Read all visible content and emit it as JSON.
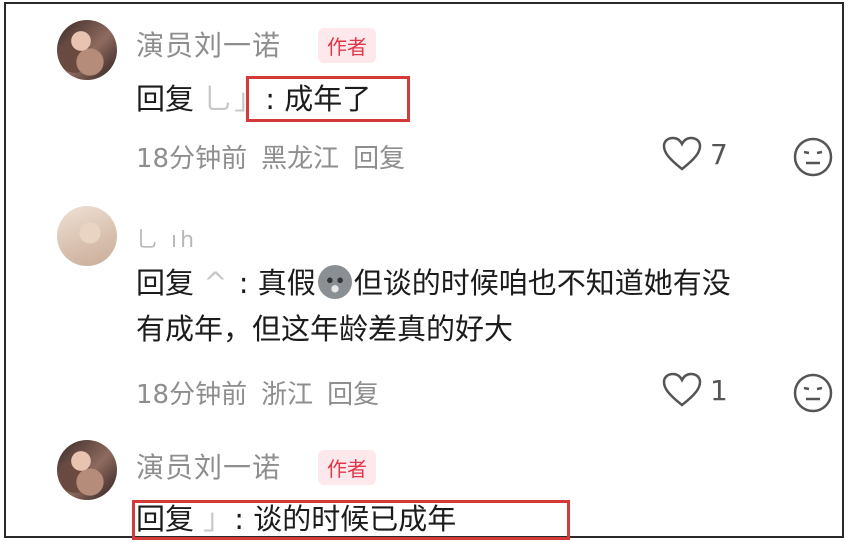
{
  "comments": [
    {
      "username": "演员刘一诺",
      "badge": "作者",
      "reply_prefix": "回复",
      "reply_target": "乚」",
      "separator": ": ",
      "text": "成年了",
      "time": "18分钟前",
      "location": "黑龙江",
      "reply_label": "回复",
      "likes": "7"
    },
    {
      "username": "乚 ıh",
      "reply_prefix": "回复",
      "reply_target": "^",
      "separator": " : ",
      "text_before_emoji": "真假",
      "emoji": "pig-face-emoji",
      "text_after_emoji": "但谈的时候咱也不知道她有没",
      "text_line2": "有成年，但这年龄差真的好大",
      "time": "18分钟前",
      "location": "浙江",
      "reply_label": "回复",
      "likes": "1"
    },
    {
      "username": "演员刘一诺",
      "badge": "作者",
      "reply_prefix": "回复",
      "reply_target": "」",
      "separator": ": ",
      "text": "谈的时候已成年"
    }
  ],
  "icons": {
    "like": "heart-outline-icon",
    "dislike": "neutral-face-icon"
  },
  "colors": {
    "highlight_box": "#d33a3a",
    "author_badge": "#e0364a"
  }
}
